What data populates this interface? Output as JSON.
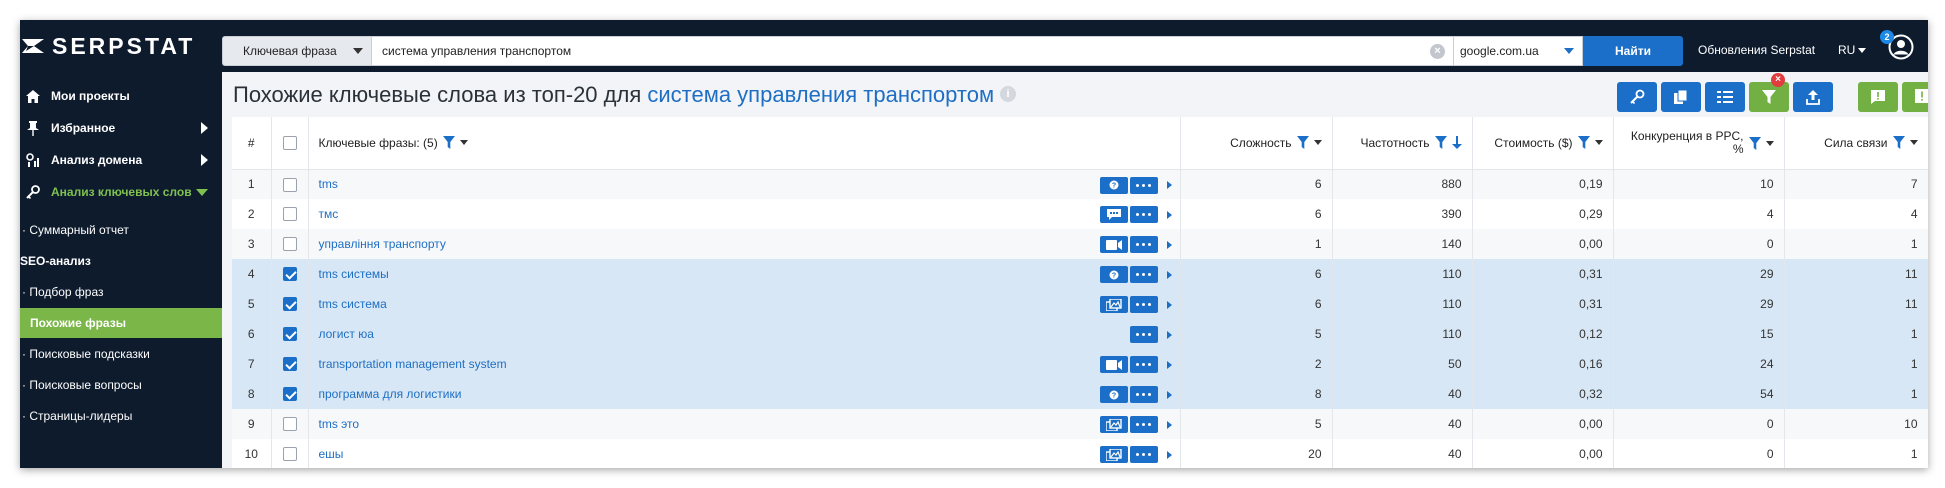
{
  "brand": {
    "name": "SERPSTAT"
  },
  "search": {
    "type_label": "Ключевая фраза",
    "query": "система управления транспортом",
    "engine": "google.com.ua",
    "find_label": "Найти"
  },
  "header": {
    "updates_label": "Обновления Serpstat",
    "lang": "RU",
    "notifications_count": "2"
  },
  "sidebar": {
    "main_items": [
      {
        "label": "Мои проекты",
        "icon": "home-icon"
      },
      {
        "label": "Избранное",
        "icon": "pin-icon"
      },
      {
        "label": "Анализ домена",
        "icon": "chart-icon"
      },
      {
        "label": "Анализ ключевых слов",
        "icon": "key-icon"
      }
    ],
    "sub_items": [
      {
        "label": "· Суммарный отчет"
      },
      {
        "label": "SEO-анализ"
      },
      {
        "label": "· Подбор фраз"
      },
      {
        "label": "Похожие фразы"
      },
      {
        "label": "· Поисковые подсказки"
      },
      {
        "label": "· Поисковые вопросы"
      },
      {
        "label": "· Страницы-лидеры"
      }
    ]
  },
  "page": {
    "title_prefix": "Похожие ключевые слова из топ-20 для ",
    "title_keyword": "система управления транспортом",
    "info_glyph": "i"
  },
  "colors": {
    "accent": "#1b6fc8",
    "nav_active": "#7ab648",
    "sidebar_bg": "#0d1b2d",
    "filter_badge": "#e23d3d"
  },
  "table": {
    "headers": {
      "num": "#",
      "keyword": "Ключевые фразы: (5)",
      "difficulty": "Сложность",
      "frequency": "Частотность",
      "cost": "Стоимость ($)",
      "competition_line1": "Конкуренция в PPC,",
      "competition_line2": "%",
      "relevance": "Сила связи"
    },
    "rows": [
      {
        "num": "1",
        "checked": false,
        "keyword": "tms",
        "feature": "question-icon",
        "difficulty": "6",
        "frequency": "880",
        "cost": "0,19",
        "competition": "10",
        "relevance": "7"
      },
      {
        "num": "2",
        "checked": false,
        "keyword": "тмс",
        "feature": "review-icon",
        "difficulty": "6",
        "frequency": "390",
        "cost": "0,29",
        "competition": "4",
        "relevance": "4"
      },
      {
        "num": "3",
        "checked": false,
        "keyword": "управління транспорту",
        "feature": "video-icon",
        "difficulty": "1",
        "frequency": "140",
        "cost": "0,00",
        "competition": "0",
        "relevance": "1"
      },
      {
        "num": "4",
        "checked": true,
        "keyword": "tms системы",
        "feature": "question-icon",
        "difficulty": "6",
        "frequency": "110",
        "cost": "0,31",
        "competition": "29",
        "relevance": "11"
      },
      {
        "num": "5",
        "checked": true,
        "keyword": "tms система",
        "feature": "images-icon",
        "difficulty": "6",
        "frequency": "110",
        "cost": "0,31",
        "competition": "29",
        "relevance": "11"
      },
      {
        "num": "6",
        "checked": true,
        "keyword": "логист юа",
        "feature": "",
        "difficulty": "5",
        "frequency": "110",
        "cost": "0,12",
        "competition": "15",
        "relevance": "1"
      },
      {
        "num": "7",
        "checked": true,
        "keyword": "transportation management system",
        "feature": "video-icon",
        "difficulty": "2",
        "frequency": "50",
        "cost": "0,16",
        "competition": "24",
        "relevance": "1"
      },
      {
        "num": "8",
        "checked": true,
        "keyword": "программа для логистики",
        "feature": "question-icon",
        "difficulty": "8",
        "frequency": "40",
        "cost": "0,32",
        "competition": "54",
        "relevance": "1"
      },
      {
        "num": "9",
        "checked": false,
        "keyword": "tms это",
        "feature": "images-icon",
        "difficulty": "5",
        "frequency": "40",
        "cost": "0,00",
        "competition": "0",
        "relevance": "10"
      },
      {
        "num": "10",
        "checked": false,
        "keyword": "ешы",
        "feature": "images-icon",
        "difficulty": "20",
        "frequency": "40",
        "cost": "0,00",
        "competition": "0",
        "relevance": "1"
      }
    ]
  }
}
